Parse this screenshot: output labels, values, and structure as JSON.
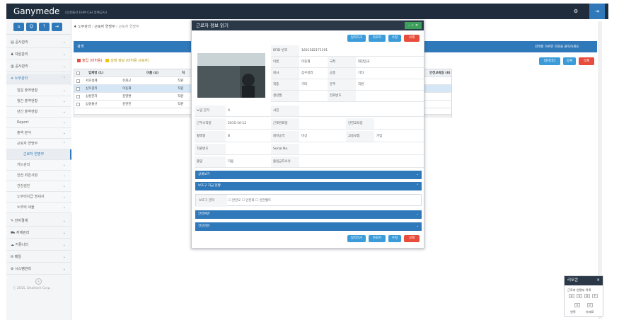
{
  "app": {
    "title": "Ganymede",
    "subtitle": "(삼성물산 EHM C&I 등록공사)"
  },
  "topbar": {
    "gear_icon": "gear-icon",
    "logout_icon": "logout-icon"
  },
  "toolbar": {
    "icons": [
      "home-icon",
      "user-icon",
      "help-icon",
      "logout-icon"
    ]
  },
  "breadcrumb": {
    "home": "노무관리",
    "sep1": "/",
    "level2": "근로자 연명부",
    "sep2": "/",
    "current": "근로자 연명부"
  },
  "sidebar": {
    "items": [
      {
        "label": "공사관리",
        "icon": "document-icon"
      },
      {
        "label": "자원관리",
        "icon": "people-icon"
      },
      {
        "label": "공사관리",
        "icon": "file-icon"
      },
      {
        "label": "노무관리",
        "icon": "worker-icon",
        "active": true
      },
      {
        "label": "일일 출역현황",
        "sub": true
      },
      {
        "label": "월간 출역현황",
        "sub": true
      },
      {
        "label": "년간 출역현황",
        "sub": true
      },
      {
        "label": "Report",
        "sub": true
      },
      {
        "label": "출역 분석",
        "sub": true
      },
      {
        "label": "근로자 연명부",
        "sub": true
      },
      {
        "label": "근로자 연명부",
        "sub": true,
        "current": true
      },
      {
        "label": "카드관리",
        "sub": true
      },
      {
        "label": "안전 위반사항",
        "sub": true
      },
      {
        "label": "건강검진",
        "sub": true
      },
      {
        "label": "노무비지급 명세서",
        "sub": true
      },
      {
        "label": "노무비 세율",
        "sub": true
      },
      {
        "label": "전자결재",
        "icon": "edit-icon"
      },
      {
        "label": "자재관리",
        "icon": "truck-icon"
      },
      {
        "label": "커뮤니티",
        "icon": "chat-icon"
      },
      {
        "label": "메일",
        "icon": "mail-icon"
      },
      {
        "label": "시스템관리",
        "icon": "settings-icon"
      }
    ],
    "footer": "ⓒ 2015, Dealtech Corp."
  },
  "main": {
    "panel_title": "검색",
    "hint": "검색할 하위한 의료을 클릭하세요.",
    "legend": [
      {
        "label": "출입 (비허용)",
        "color": "#e74c3c"
      },
      {
        "label": "상태 정보 (비허용 근로자)",
        "color": "#f1c40f"
      }
    ],
    "buttons": {
      "download": "데이터다",
      "add": "등록",
      "delete": "삭제"
    },
    "grid": {
      "headers": [
        "업체명 (1)",
        "이름 (4)",
        "직"
      ],
      "extra_header": "안전교육일 (8)",
      "rows": [
        [
          "서호설계",
          "유회근",
          "직원"
        ],
        [
          "삼우감리",
          "이동재",
          "직원"
        ],
        [
          "삼성전자",
          "김영환",
          "직원"
        ],
        [
          "삼성물산",
          "김현진",
          "직원"
        ]
      ]
    }
  },
  "modal": {
    "title": "근로자 정보 읽기",
    "buttons": {
      "print": "일력하기",
      "edit_card": "카로카",
      "modify": "수정",
      "delete": "삭제"
    },
    "fields": [
      {
        "label": "RFID 번호",
        "value": "1601382171191",
        "label2": "",
        "value2": ""
      },
      {
        "label": "이름",
        "value": "이동재",
        "label2": "국적",
        "value2": "대한민국"
      },
      {
        "label": "회사",
        "value": "삼우감리",
        "label2": "공종",
        "value2": "기타"
      },
      {
        "label": "직종",
        "value": "기타",
        "label2": "분주",
        "value2": "직원"
      },
      {
        "label": "생년월",
        "value": "",
        "label2": "전화번호",
        "value2": ""
      },
      {
        "label": "노임 단가",
        "value": "0",
        "label2": "사진",
        "value2": ""
      },
      {
        "label": "근무시작일",
        "value": "2015-10-12",
        "label2": "근로완료일",
        "value2": "",
        "label3": "안전교육일",
        "value3": ""
      },
      {
        "label": "혈액형",
        "value": "B",
        "label2": "회학공격",
        "value2": "미상",
        "label3": "고용보험",
        "value3": "가입"
      },
      {
        "label": "직원번호",
        "value": "",
        "label2": "Serial No.",
        "value2": ""
      },
      {
        "label": "출입",
        "value": "허용",
        "label2": "출입금지사유",
        "value2": ""
      }
    ],
    "sections": {
      "detail": "상세보기",
      "protect": "보호구 지급 현황",
      "protect_label": "보호구 관리",
      "protect_opts": [
        "안전모",
        "안전화",
        "안전벨트"
      ],
      "safety": "안전위반",
      "health": "건강검진"
    }
  },
  "mini": {
    "title": "리모콘",
    "line1": "근로자 연명부 목록",
    "keys1": [
      "A",
      "S",
      "D",
      "F"
    ],
    "keys2": [
      "<",
      ">"
    ],
    "labels": [
      "왼쪽",
      "아래로"
    ]
  }
}
